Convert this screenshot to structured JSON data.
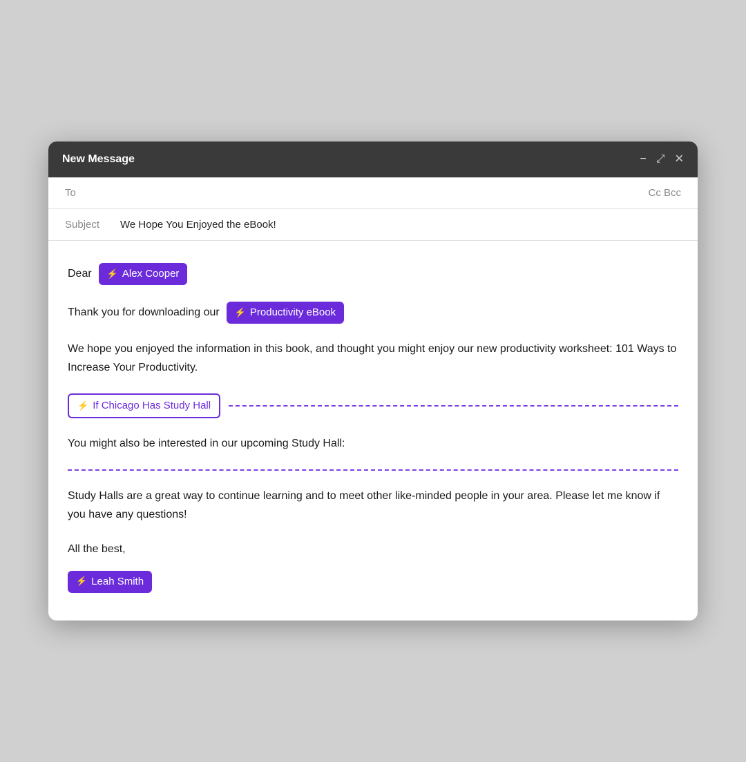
{
  "header": {
    "title": "New Message",
    "minimize_label": "−",
    "expand_label": "⤢",
    "close_label": "✕"
  },
  "to_row": {
    "label": "To",
    "cc_bcc": "Cc Bcc"
  },
  "subject_row": {
    "label": "Subject",
    "value": "We Hope You Enjoyed the eBook!"
  },
  "email_body": {
    "dear_text": "Dear",
    "recipient_tag": "Alex Cooper",
    "thank_you_text": "Thank you for downloading our",
    "ebook_tag": "Productivity eBook",
    "paragraph1": "We hope you enjoyed the information in this book, and thought you might enjoy our new productivity worksheet: 101 Ways to Increase Your Productivity.",
    "conditional_tag": "If Chicago Has Study Hall",
    "study_hall_intro": "You might also be interested in our upcoming Study Hall:",
    "study_hall_body": "Study Halls are a great way to continue learning and to meet other like-minded people in your area. Please let me know if you have any questions!",
    "sign_off": "All the best,",
    "sender_tag": "Leah Smith"
  },
  "colors": {
    "accent": "#6c2bdb",
    "header_bg": "#3a3a3a",
    "dashed": "#7b40e0"
  }
}
